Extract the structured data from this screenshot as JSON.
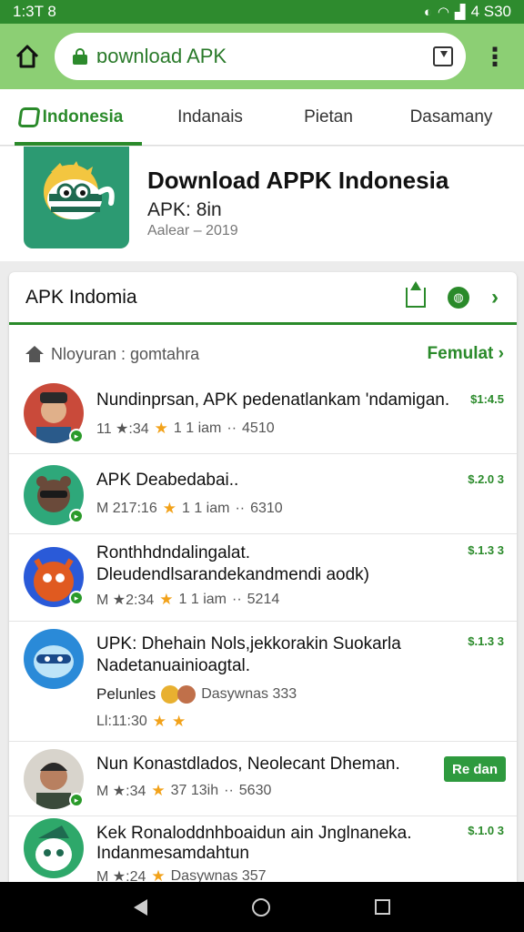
{
  "status_bar": {
    "time": "1:3T 8",
    "right_text": "4 S30"
  },
  "browser": {
    "url": "ɒownload APK"
  },
  "tabs": [
    {
      "label": "Indonesia"
    },
    {
      "label": "Indanais"
    },
    {
      "label": "Pietan"
    },
    {
      "label": "Dasamany"
    }
  ],
  "app": {
    "title": "Download APPK Indonesia",
    "subtitle": "APK: 8in",
    "meta": "Aalear – 2019"
  },
  "card": {
    "title": "APK Indomia",
    "section_label": "Nloyuran : gomtahra",
    "section_link": "Femulat"
  },
  "items": [
    {
      "title": "Nundinprsan, APK pedenatlankam 'ndamigan.",
      "meta_a": "11 ★:34",
      "meta_b": "1 1 iam",
      "meta_c": "4510",
      "price": "$1:4.5",
      "avatar_color": "#c94a3a"
    },
    {
      "title": "APK Deabedabai..",
      "meta_a": "M 217:16",
      "meta_b": "1 1 iam",
      "meta_c": "6310",
      "price": "$.2.0 3",
      "avatar_color": "#2ea87a"
    },
    {
      "title": "Ronthhdndalingalat.",
      "title2": "Dleudendlsarandekandmendi aodk)",
      "meta_a": "M ★2:34",
      "meta_b": "1 1 iam",
      "meta_c": "5214",
      "price": "$.1.3 3",
      "avatar_color": "#e05a20"
    },
    {
      "title": "UPK: Dhehain Nols,jekkorakin Suokarla",
      "title2": "Nadetanuainioagtal.",
      "extra_label": "Pelunles",
      "extra_text": "Dasywnas 333",
      "meta_a": "Ll:11:30",
      "price": "$.1.3 3",
      "avatar_color": "#2a8ad8"
    },
    {
      "title": "Nun Konastdlados, Neolecant Dheman.",
      "meta_a": "M ★:34",
      "meta_b": "37 13ih",
      "meta_c": "5630",
      "button": "Re dan",
      "avatar_color": "#7a6a5a"
    },
    {
      "title": "Kek Ronaloddnhboaidun ain Jnglnaneka.",
      "title2": "Indanmesamdahtun",
      "meta_a": "M ★:24",
      "meta_b": "Dasywnas 357",
      "price": "$.1.0 3",
      "avatar_color": "#2ea86a"
    }
  ]
}
